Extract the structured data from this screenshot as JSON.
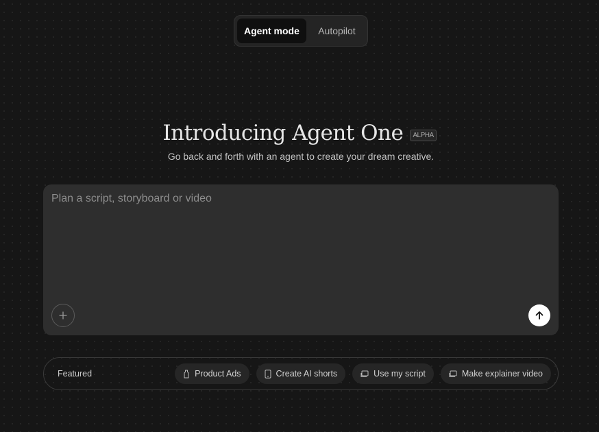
{
  "mode_toggle": {
    "active_label": "Agent mode",
    "inactive_label": "Autopilot"
  },
  "hero": {
    "title": "Introducing Agent One",
    "badge": "ALPHA",
    "subtitle": "Go back and forth with an agent to create your dream creative."
  },
  "prompt": {
    "placeholder": "Plan a script, storyboard or video",
    "value": "",
    "add_icon": "plus-icon",
    "send_icon": "arrow-up-icon"
  },
  "featured": {
    "label": "Featured",
    "chips": [
      {
        "label": "Product Ads",
        "icon": "bottle-icon"
      },
      {
        "label": "Create AI shorts",
        "icon": "phone-icon"
      },
      {
        "label": "Use my script",
        "icon": "script-icon"
      },
      {
        "label": "Make explainer video",
        "icon": "script-icon"
      }
    ]
  },
  "colors": {
    "background": "#161616",
    "panel": "#2e2e2e",
    "send_button": "#ffffff"
  }
}
